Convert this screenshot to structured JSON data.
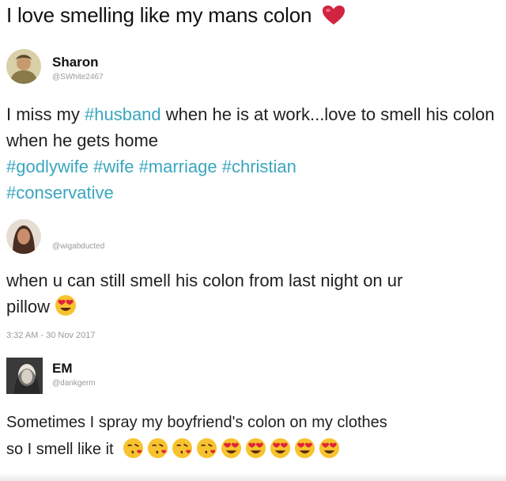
{
  "header": {
    "title": "I love smelling like my mans colon",
    "icon": "heart-icon"
  },
  "post1": {
    "name": "Sharon",
    "handle": "@SWhite2467",
    "text_a": "I miss my ",
    "tag_husband": "#husband",
    "text_b": " when he is at work...love to smell his colon when he gets home",
    "tags": [
      "#godlywife",
      "#wife",
      "#marriage",
      "#christian",
      "#conservative"
    ]
  },
  "post2": {
    "handle": "@wigabducted",
    "text": "when u can still smell his colon from last night on ur pillow",
    "emoji": "heart-eyes-icon",
    "timestamp": "3:32 AM - 30 Nov 2017"
  },
  "post3": {
    "name": "EM",
    "handle": "@dankgerm",
    "text_line1": "Sometimes I spray my boyfriend's colon on my clothes",
    "text_line2": "so I smell like it",
    "emojis": [
      "kiss-face-icon",
      "kiss-face-icon",
      "kiss-face-icon",
      "kiss-face-icon",
      "heart-eyes-icon",
      "heart-eyes-icon",
      "heart-eyes-icon",
      "heart-eyes-icon",
      "heart-eyes-icon"
    ]
  },
  "colors": {
    "hashtag": "#3aa6bf",
    "heart": "#d0243f"
  }
}
